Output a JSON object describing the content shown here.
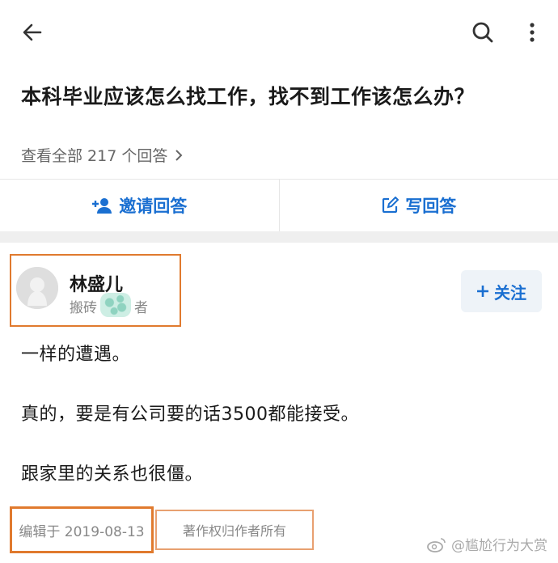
{
  "question": {
    "title": "本科毕业应该怎么找工作，找不到工作该怎么办？",
    "all_answers": "查看全部 217 个回答"
  },
  "actions": {
    "invite": "邀请回答",
    "write": "写回答"
  },
  "answer": {
    "author_name": "林盛儿",
    "author_tag_start": "搬砖",
    "author_tag_end": "者",
    "follow": "关注",
    "paragraphs": [
      "一样的遭遇。",
      "真的，要是有公司要的话3500都能接受。",
      "跟家里的关系也很僵。"
    ],
    "edited": "编辑于 2019-08-13",
    "copyright": "著作权归作者所有"
  },
  "watermark": "@尴尬行为大赏",
  "colors": {
    "accent": "#1a6fd1",
    "highlight": "#e07a2e"
  }
}
